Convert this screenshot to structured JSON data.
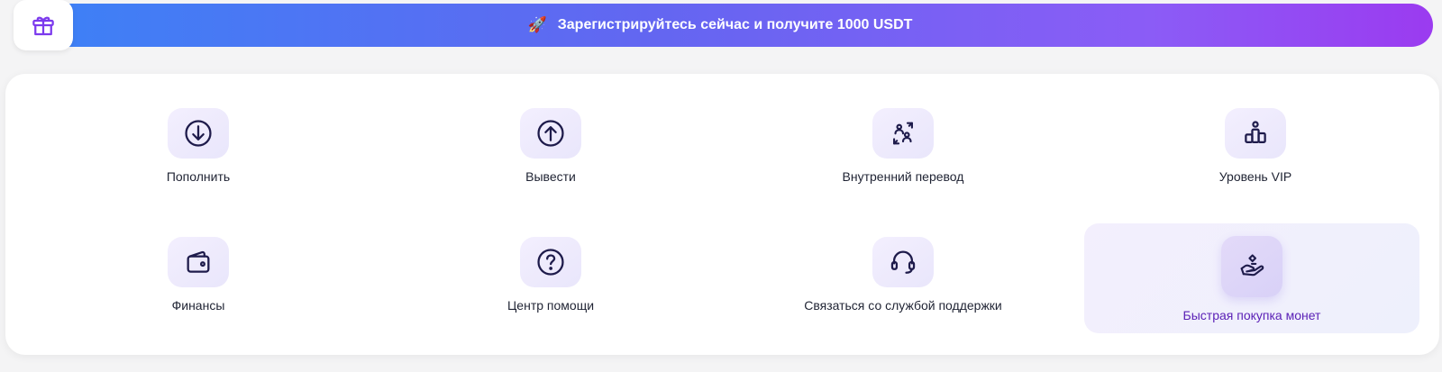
{
  "banner": {
    "text": "Зарегистрируйтесь сейчас и получите 1000 USDT",
    "icon": "rocket-icon"
  },
  "gift": {
    "icon": "gift-icon"
  },
  "actions": [
    {
      "label": "Пополнить",
      "icon": "deposit-icon"
    },
    {
      "label": "Вывести",
      "icon": "withdraw-icon"
    },
    {
      "label": "Внутренний перевод",
      "icon": "transfer-icon"
    },
    {
      "label": "Уровень VIP",
      "icon": "vip-level-icon"
    },
    {
      "label": "Финансы",
      "icon": "wallet-icon"
    },
    {
      "label": "Центр помощи",
      "icon": "help-icon"
    },
    {
      "label": "Связаться со службой поддержки",
      "icon": "headset-icon"
    },
    {
      "label": "Быстрая покупка монет",
      "icon": "quick-buy-icon",
      "active": true
    }
  ],
  "colors": {
    "accent": "#7c3aed",
    "icon_stroke": "#1e1b4b",
    "active_label": "#5b21b6"
  }
}
